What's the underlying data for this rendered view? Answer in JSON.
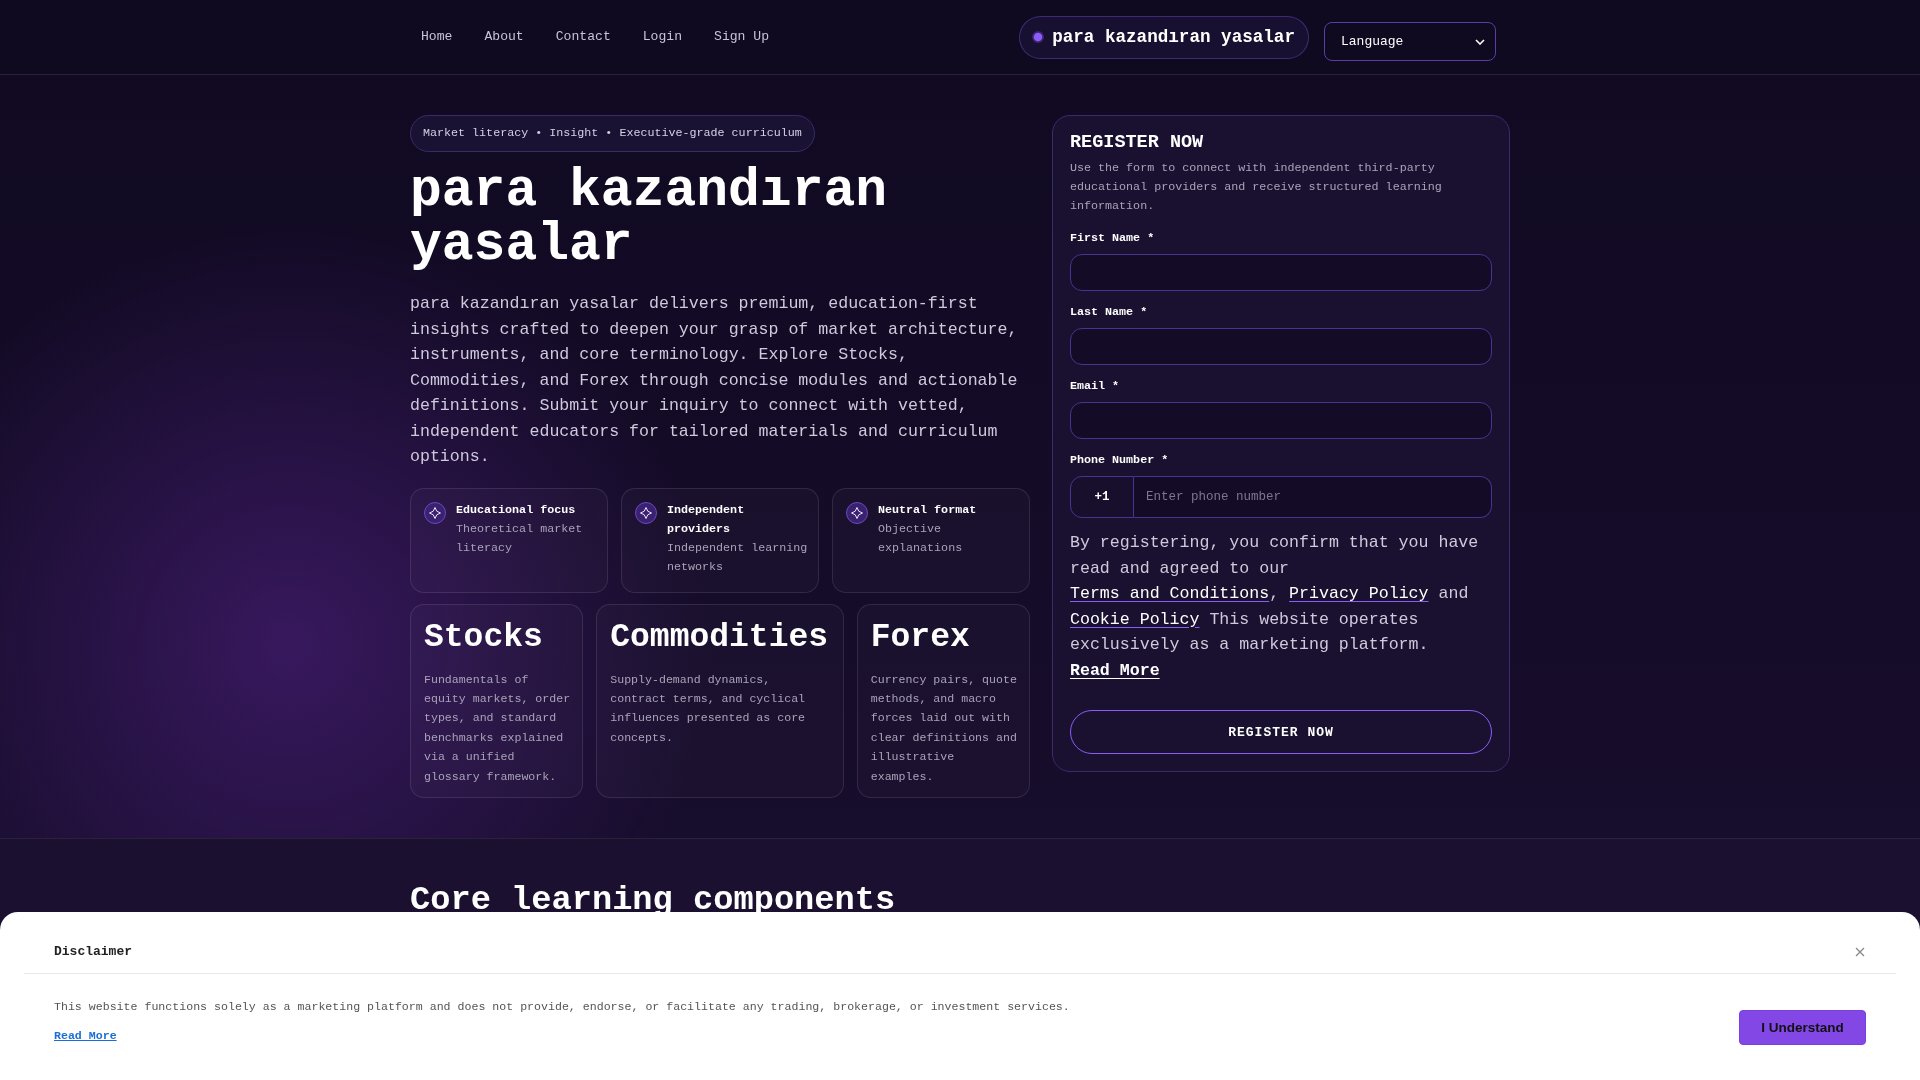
{
  "nav": {
    "links": [
      "Home",
      "About",
      "Contact",
      "Login",
      "Sign Up"
    ],
    "brand": "para kazandıran yasalar",
    "language_select": {
      "value": "Language"
    }
  },
  "hero": {
    "tagline": "Market literacy • Insight • Executive-grade curriculum",
    "title": "para kazandıran yasalar",
    "intro": "para kazandıran yasalar delivers premium, education-first insights crafted to deepen your grasp of market architecture, instruments, and core terminology. Explore Stocks, Commodities, and Forex through concise modules and actionable definitions. Submit your inquiry to connect with vetted, independent educators for tailored materials and curriculum options.",
    "features": [
      {
        "title": "Educational focus",
        "text": "Theoretical market literacy"
      },
      {
        "title": "Independent providers",
        "text": "Independent learning networks"
      },
      {
        "title": "Neutral format",
        "text": "Objective explanations"
      }
    ],
    "topics": [
      {
        "title": "Stocks",
        "text": "Fundamentals of equity markets, order types, and standard benchmarks explained via a unified glossary framework."
      },
      {
        "title": "Commodities",
        "text": "Supply-demand dynamics, contract terms, and cyclical influences presented as core concepts."
      },
      {
        "title": "Forex",
        "text": "Currency pairs, quote methods, and macro forces laid out with clear definitions and illustrative examples."
      }
    ]
  },
  "register_form": {
    "title": "REGISTER NOW",
    "description": "Use the form to connect with independent third-party educational providers and receive structured learning information.",
    "fields": [
      {
        "kind": "text",
        "label": "First Name *"
      },
      {
        "kind": "text",
        "label": "Last Name *"
      },
      {
        "kind": "email",
        "label": "Email *"
      },
      {
        "kind": "phone",
        "label": "Phone Number *",
        "prefix": "+1",
        "placeholder": "Enter phone number"
      }
    ],
    "consent": [
      {
        "kind": "text",
        "text": "By registering, you confirm that you have read and agreed to our "
      },
      {
        "kind": "link",
        "text": "Terms and Conditions"
      },
      {
        "kind": "text",
        "text": ", "
      },
      {
        "kind": "link",
        "text": "Privacy Policy"
      },
      {
        "kind": "text",
        "text": " and "
      },
      {
        "kind": "link",
        "text": "Cookie Policy"
      },
      {
        "kind": "text",
        "text": " This website operates exclusively as a marketing platform. "
      },
      {
        "kind": "strong_link",
        "text": "Read More"
      }
    ],
    "submit": "REGISTER NOW"
  },
  "section": {
    "title": "Core learning components"
  },
  "disclaimer": {
    "title": "Disclaimer",
    "text": "This website functions solely as a marketing platform and does not provide, endorse, or facilitate any trading, brokerage, or investment services.",
    "link": "Read More",
    "button": "I Understand"
  }
}
